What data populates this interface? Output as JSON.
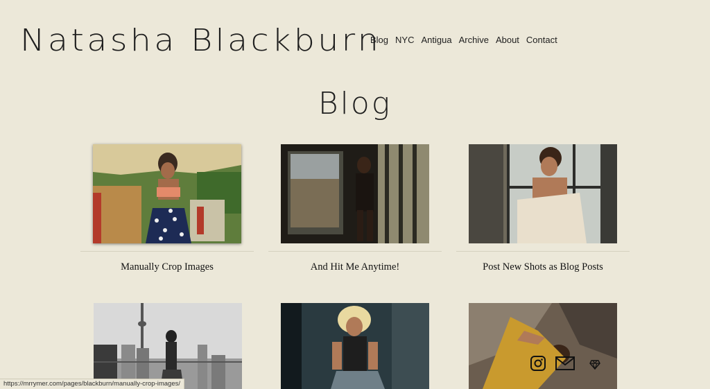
{
  "site": {
    "title": "Natasha Blackburn"
  },
  "nav": [
    {
      "label": "Blog"
    },
    {
      "label": "NYC"
    },
    {
      "label": "Antigua"
    },
    {
      "label": "Archive"
    },
    {
      "label": "About"
    },
    {
      "label": "Contact"
    }
  ],
  "page": {
    "heading": "Blog"
  },
  "posts": [
    {
      "title": "Manually Crop Images",
      "image": "outdoor portrait, orange bikini top, polka-dot skirt"
    },
    {
      "title": "And Hit Me Anytime!",
      "image": "portrait by window, dark interior"
    },
    {
      "title": "Post New Shots as Blog Posts",
      "image": "portrait by window, cream knit sweater"
    },
    {
      "title": "",
      "image": "black and white rooftop city portrait"
    },
    {
      "title": "",
      "image": "portrait with blonde curly hair, dark background"
    },
    {
      "title": "",
      "image": "portrait in mustard top against stone"
    }
  ],
  "status_bar": {
    "url": "https://mrrymer.com/pages/blackburn/manually-crop-images/"
  },
  "social": [
    {
      "icon": "instagram-icon"
    },
    {
      "icon": "mail-icon"
    },
    {
      "icon": "diamond-icon"
    }
  ],
  "colors": {
    "background": "#ece8d9",
    "text": "#1e1e1e",
    "rule": "#d6d1bf"
  }
}
